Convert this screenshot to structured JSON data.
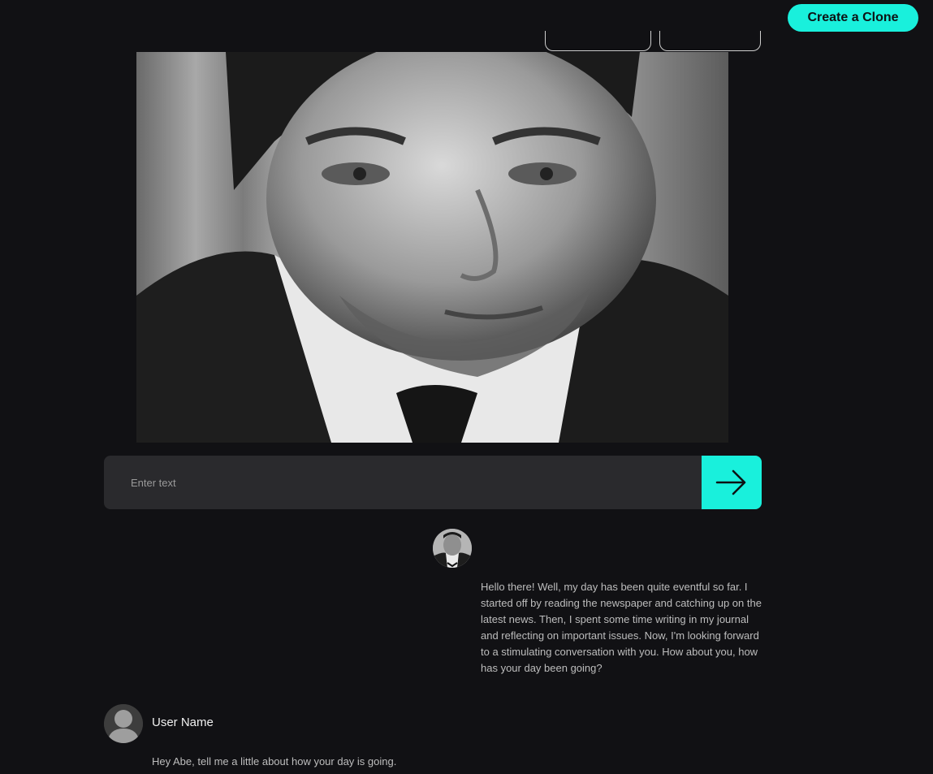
{
  "header": {
    "create_clone_label": "Create a Clone"
  },
  "portrait": {
    "icon": "portrait-image"
  },
  "chat_input": {
    "placeholder": "Enter text",
    "value": "",
    "send_icon": "arrow-right-icon"
  },
  "messages": [
    {
      "role": "bot",
      "avatar_icon": "bot-avatar-image",
      "text": "Hello there! Well, my day has been quite eventful so far. I started off by reading the newspaper and catching up on the latest news. Then, I spent some time writing in my journal and reflecting on important issues. Now, I'm looking forward to a stimulating conversation with you. How about you, how has your day been going?"
    },
    {
      "role": "user",
      "avatar_icon": "user-avatar-icon",
      "name": "User Name",
      "text": "Hey Abe, tell me a little about how your day is going."
    }
  ],
  "colors": {
    "background": "#111114",
    "accent": "#19f0dc",
    "input_bg": "#2a2a2d"
  }
}
